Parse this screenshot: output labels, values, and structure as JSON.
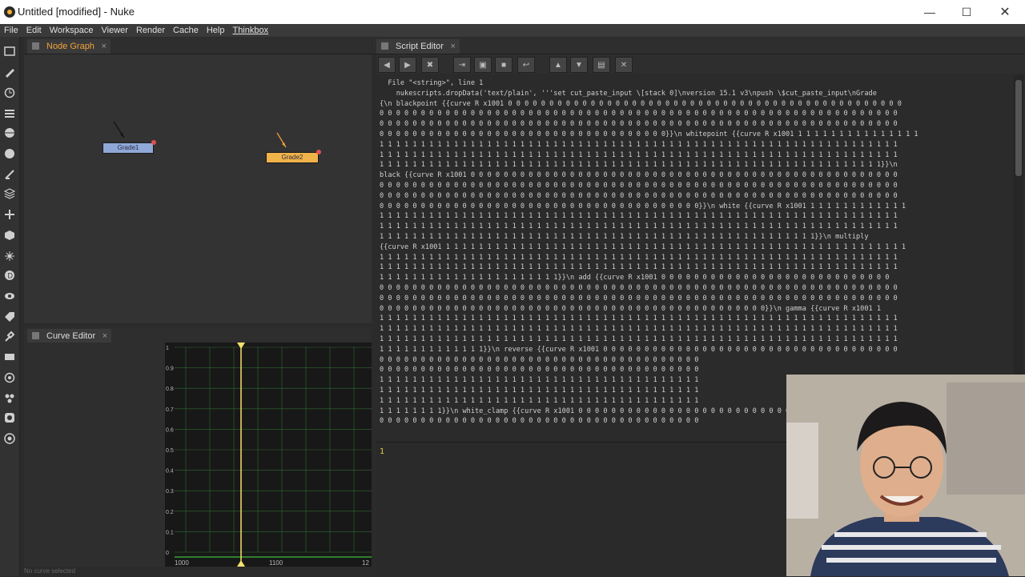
{
  "window": {
    "title": "Untitled [modified] - Nuke",
    "controls": [
      "minimize",
      "maximize",
      "close"
    ]
  },
  "menu": [
    "File",
    "Edit",
    "Workspace",
    "Viewer",
    "Render",
    "Cache",
    "Help",
    "Thinkbox"
  ],
  "toolbar_icons": [
    "image-icon",
    "draw-icon",
    "time-icon",
    "channel-icon",
    "color-icon",
    "filter-icon",
    "keyer-icon",
    "merge-icon",
    "transform-icon",
    "3d-icon",
    "particles-icon",
    "deep-icon",
    "views-icon",
    "metadata-icon",
    "toolsets-icon",
    "other-icon",
    "furnace-icon",
    "ocula-icon",
    "cara-icon",
    "nuke-logo-icon"
  ],
  "node_graph": {
    "tab_label": "Node Graph",
    "nodes": [
      {
        "label": "Grade1",
        "selected": false
      },
      {
        "label": "Grade2",
        "selected": true
      }
    ]
  },
  "curve_editor": {
    "tab_label": "Curve Editor",
    "y_ticks": [
      "1",
      "0.9",
      "0.8",
      "0.7",
      "0.6",
      "0.5",
      "0.4",
      "0.3",
      "0.2",
      "0.1",
      "0"
    ],
    "x_ticks": [
      "1000",
      "1100",
      "12"
    ],
    "status": "No curve selected"
  },
  "script_editor": {
    "tab_label": "Script Editor",
    "output_lines": [
      "  File \"<string>\", line 1",
      "    nukescripts.dropData('text/plain', '''set cut_paste_input \\[stack 0]\\nversion 15.1 v3\\npush \\$cut_paste_input\\nGrade",
      "{\\n blackpoint {{curve R x1001 0 0 0 0 0 0 0 0 0 0 0 0 0 0 0 0 0 0 0 0 0 0 0 0 0 0 0 0 0 0 0 0 0 0 0 0 0 0 0 0 0 0 0 0 0 0 0 0",
      "0 0 0 0 0 0 0 0 0 0 0 0 0 0 0 0 0 0 0 0 0 0 0 0 0 0 0 0 0 0 0 0 0 0 0 0 0 0 0 0 0 0 0 0 0 0 0 0 0 0 0 0 0 0 0 0 0 0 0 0 0 0 0",
      "0 0 0 0 0 0 0 0 0 0 0 0 0 0 0 0 0 0 0 0 0 0 0 0 0 0 0 0 0 0 0 0 0 0 0 0 0 0 0 0 0 0 0 0 0 0 0 0 0 0 0 0 0 0 0 0 0 0 0 0 0 0 0",
      "0 0 0 0 0 0 0 0 0 0 0 0 0 0 0 0 0 0 0 0 0 0 0 0 0 0 0 0 0 0 0 0 0 0 0}}\\n whitepoint {{curve R x1001 1 1 1 1 1 1 1 1 1 1 1 1 1 1 1",
      "1 1 1 1 1 1 1 1 1 1 1 1 1 1 1 1 1 1 1 1 1 1 1 1 1 1 1 1 1 1 1 1 1 1 1 1 1 1 1 1 1 1 1 1 1 1 1 1 1 1 1 1 1 1 1 1 1 1 1 1 1 1 1",
      "1 1 1 1 1 1 1 1 1 1 1 1 1 1 1 1 1 1 1 1 1 1 1 1 1 1 1 1 1 1 1 1 1 1 1 1 1 1 1 1 1 1 1 1 1 1 1 1 1 1 1 1 1 1 1 1 1 1 1 1 1 1 1",
      "1 1 1 1 1 1 1 1 1 1 1 1 1 1 1 1 1 1 1 1 1 1 1 1 1 1 1 1 1 1 1 1 1 1 1 1 1 1 1 1 1 1 1 1 1 1 1 1 1 1 1 1 1 1 1 1 1 1 1 1 1}}\\n",
      "black {{curve R x1001 0 0 0 0 0 0 0 0 0 0 0 0 0 0 0 0 0 0 0 0 0 0 0 0 0 0 0 0 0 0 0 0 0 0 0 0 0 0 0 0 0 0 0 0 0 0 0 0 0 0 0 0",
      "0 0 0 0 0 0 0 0 0 0 0 0 0 0 0 0 0 0 0 0 0 0 0 0 0 0 0 0 0 0 0 0 0 0 0 0 0 0 0 0 0 0 0 0 0 0 0 0 0 0 0 0 0 0 0 0 0 0 0 0 0 0 0",
      "0 0 0 0 0 0 0 0 0 0 0 0 0 0 0 0 0 0 0 0 0 0 0 0 0 0 0 0 0 0 0 0 0 0 0 0 0 0 0 0 0 0 0 0 0 0 0 0 0 0 0 0 0 0 0 0 0 0 0 0 0 0 0",
      "0 0 0 0 0 0 0 0 0 0 0 0 0 0 0 0 0 0 0 0 0 0 0 0 0 0 0 0 0 0 0 0 0 0 0 0 0 0 0}}\\n white {{curve R x1001 1 1 1 1 1 1 1 1 1 1 1 1",
      "1 1 1 1 1 1 1 1 1 1 1 1 1 1 1 1 1 1 1 1 1 1 1 1 1 1 1 1 1 1 1 1 1 1 1 1 1 1 1 1 1 1 1 1 1 1 1 1 1 1 1 1 1 1 1 1 1 1 1 1 1 1 1",
      "1 1 1 1 1 1 1 1 1 1 1 1 1 1 1 1 1 1 1 1 1 1 1 1 1 1 1 1 1 1 1 1 1 1 1 1 1 1 1 1 1 1 1 1 1 1 1 1 1 1 1 1 1 1 1 1 1 1 1 1 1 1 1",
      "1 1 1 1 1 1 1 1 1 1 1 1 1 1 1 1 1 1 1 1 1 1 1 1 1 1 1 1 1 1 1 1 1 1 1 1 1 1 1 1 1 1 1 1 1 1 1 1 1 1 1 1 1}}\\n multiply",
      "{{curve R x1001 1 1 1 1 1 1 1 1 1 1 1 1 1 1 1 1 1 1 1 1 1 1 1 1 1 1 1 1 1 1 1 1 1 1 1 1 1 1 1 1 1 1 1 1 1 1 1 1 1 1 1 1 1 1 1 1",
      "1 1 1 1 1 1 1 1 1 1 1 1 1 1 1 1 1 1 1 1 1 1 1 1 1 1 1 1 1 1 1 1 1 1 1 1 1 1 1 1 1 1 1 1 1 1 1 1 1 1 1 1 1 1 1 1 1 1 1 1 1 1 1",
      "1 1 1 1 1 1 1 1 1 1 1 1 1 1 1 1 1 1 1 1 1 1 1 1 1 1 1 1 1 1 1 1 1 1 1 1 1 1 1 1 1 1 1 1 1 1 1 1 1 1 1 1 1 1 1 1 1 1 1 1 1 1 1",
      "1 1 1 1 1 1 1 1 1 1 1 1 1 1 1 1 1 1 1 1 1 1}}\\n add {{curve R x1001 0 0 0 0 0 0 0 0 0 0 0 0 0 0 0 0 0 0 0 0 0 0 0 0 0 0 0 0",
      "0 0 0 0 0 0 0 0 0 0 0 0 0 0 0 0 0 0 0 0 0 0 0 0 0 0 0 0 0 0 0 0 0 0 0 0 0 0 0 0 0 0 0 0 0 0 0 0 0 0 0 0 0 0 0 0 0 0 0 0 0 0 0",
      "0 0 0 0 0 0 0 0 0 0 0 0 0 0 0 0 0 0 0 0 0 0 0 0 0 0 0 0 0 0 0 0 0 0 0 0 0 0 0 0 0 0 0 0 0 0 0 0 0 0 0 0 0 0 0 0 0 0 0 0 0 0 0",
      "0 0 0 0 0 0 0 0 0 0 0 0 0 0 0 0 0 0 0 0 0 0 0 0 0 0 0 0 0 0 0 0 0 0 0 0 0 0 0 0 0 0 0 0 0 0 0}}\\n gamma {{curve R x1001 1",
      "1 1 1 1 1 1 1 1 1 1 1 1 1 1 1 1 1 1 1 1 1 1 1 1 1 1 1 1 1 1 1 1 1 1 1 1 1 1 1 1 1 1 1 1 1 1 1 1 1 1 1 1 1 1 1 1 1 1 1 1 1 1 1",
      "1 1 1 1 1 1 1 1 1 1 1 1 1 1 1 1 1 1 1 1 1 1 1 1 1 1 1 1 1 1 1 1 1 1 1 1 1 1 1 1 1 1 1 1 1 1 1 1 1 1 1 1 1 1 1 1 1 1 1 1 1 1 1",
      "1 1 1 1 1 1 1 1 1 1 1 1 1 1 1 1 1 1 1 1 1 1 1 1 1 1 1 1 1 1 1 1 1 1 1 1 1 1 1 1 1 1 1 1 1 1 1 1 1 1 1 1 1 1 1 1 1 1 1 1 1 1 1",
      "1 1 1 1 1 1 1 1 1 1 1 1 1}}\\n reverse {{curve R x1001 0 0 0 0 0 0 0 0 0 0 0 0 0 0 0 0 0 0 0 0 0 0 0 0 0 0 0 0 0 0 0 0 0 0 0 0",
      "0 0 0 0 0 0 0 0 0 0 0 0 0 0 0 0 0 0 0 0 0 0 0 0 0 0 0 0 0 0 0 0 0 0 0 0 0 0 0",
      "0 0 0 0 0 0 0 0 0 0 0 0 0 0 0 0 0 0 0 0 0 0 0 0 0 0 0 0 0 0 0 0 0 0 0 0 0 0 0",
      "1 1 1 1 1 1 1 1 1 1 1 1 1 1 1 1 1 1 1 1 1 1 1 1 1 1 1 1 1 1 1 1 1 1 1 1 1 1 1",
      "1 1 1 1 1 1 1 1 1 1 1 1 1 1 1 1 1 1 1 1 1 1 1 1 1 1 1 1 1 1 1 1 1 1 1 1 1 1 1",
      "1 1 1 1 1 1 1 1 1 1 1 1 1 1 1 1 1 1 1 1 1 1 1 1 1 1 1 1 1 1 1 1 1 1 1 1 1 1 1",
      "1 1 1 1 1 1 1 1}}\\n white_clamp {{curve R x1001 0 0 0 0 0 0 0 0 0 0 0 0 0 0 0 0 0 0 0 0 0 0 0 0 0 0",
      "0 0 0 0 0 0 0 0 0 0 0 0 0 0 0 0 0 0 0 0 0 0 0 0 0 0 0 0 0 0 0 0 0 0 0 0 0 0 0"
    ],
    "input_line_number": "1"
  },
  "colors": {
    "accent_orange": "#f2a33a",
    "node_grade1": "#8fa8d8",
    "node_grade2": "#f0b34a",
    "playhead": "#f5e26a",
    "grid_green": "#2f6a2f"
  }
}
